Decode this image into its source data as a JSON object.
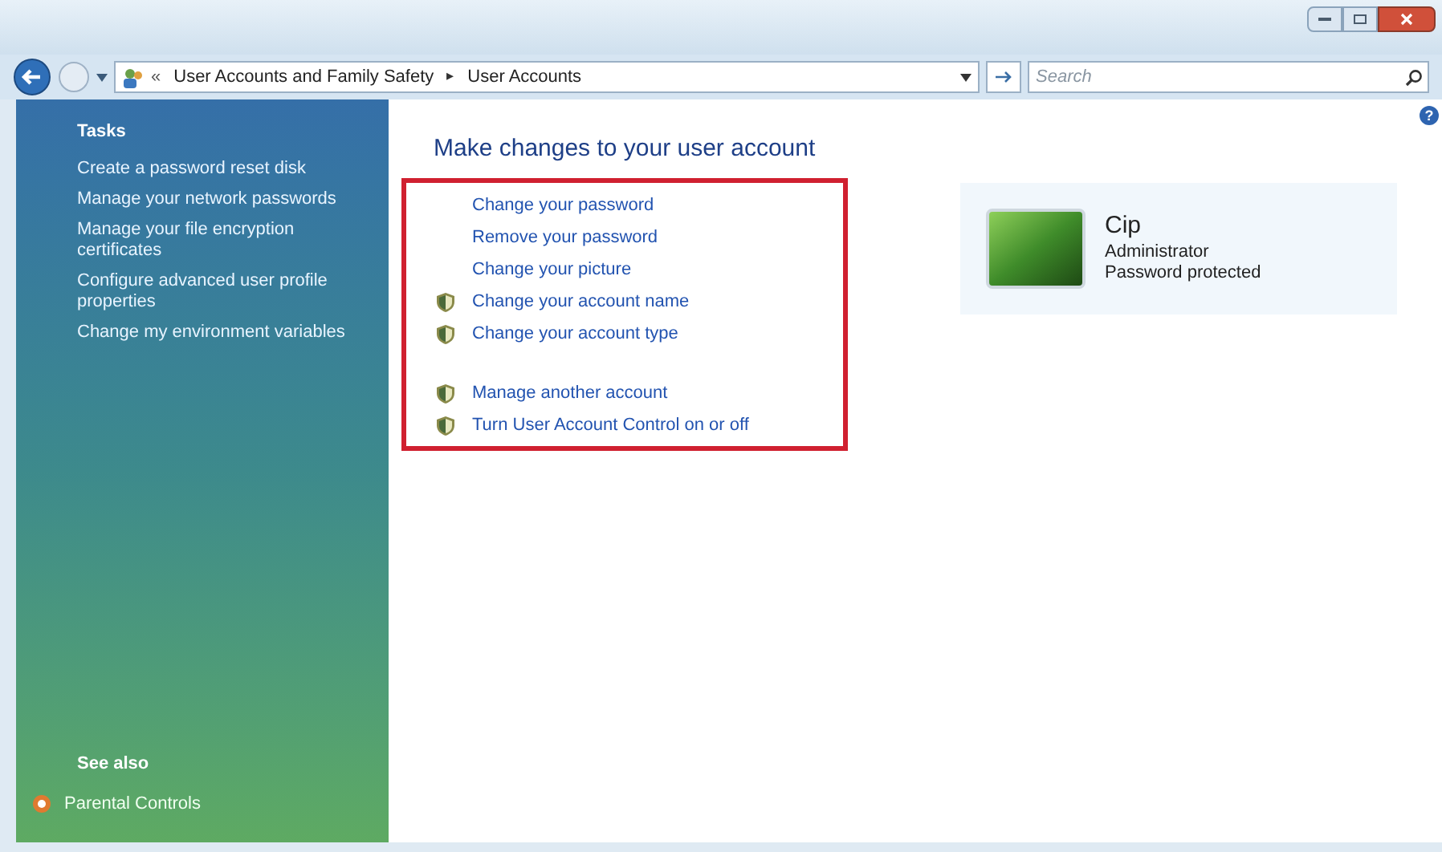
{
  "address_bar": {
    "overflow": "«",
    "path": [
      "User Accounts and Family Safety",
      "User Accounts"
    ],
    "separator": "▸"
  },
  "search": {
    "placeholder": "Search"
  },
  "help": "?",
  "sidebar": {
    "tasks_heading": "Tasks",
    "tasks": [
      "Create a password reset disk",
      "Manage your network passwords",
      "Manage your file encryption certificates",
      "Configure advanced user profile properties",
      "Change my environment variables"
    ],
    "see_also_heading": "See also",
    "see_also": [
      {
        "label": "Parental Controls"
      }
    ]
  },
  "heading": "Make changes to your user account",
  "link_groups": [
    [
      {
        "label": "Change your password",
        "kind": "plain"
      },
      {
        "label": "Remove your password",
        "kind": "plain"
      },
      {
        "label": "Change your picture",
        "kind": "plain"
      },
      {
        "label": "Change your account name",
        "kind": "shield"
      },
      {
        "label": "Change your account type",
        "kind": "shield"
      }
    ],
    [
      {
        "label": "Manage another account",
        "kind": "shield"
      },
      {
        "label": "Turn User Account Control on or off",
        "kind": "shield"
      }
    ]
  ],
  "account": {
    "name": "Cip",
    "role": "Administrator",
    "status": "Password protected"
  }
}
